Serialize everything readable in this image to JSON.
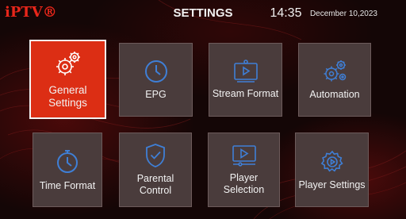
{
  "header": {
    "logo": "iPTV®",
    "title": "SETTINGS",
    "time": "14:35",
    "date": "December 10,2023"
  },
  "tiles": [
    {
      "label": "General Settings",
      "icon": "gears-icon",
      "selected": true
    },
    {
      "label": "EPG",
      "icon": "clock-icon",
      "selected": false
    },
    {
      "label": "Stream Format",
      "icon": "video-player-icon",
      "selected": false
    },
    {
      "label": "Automation",
      "icon": "automation-gears-icon",
      "selected": false
    },
    {
      "label": "Time Format",
      "icon": "stopwatch-icon",
      "selected": false
    },
    {
      "label": "Parental Control",
      "icon": "shield-check-icon",
      "selected": false
    },
    {
      "label": "Player Selection",
      "icon": "player-selection-icon",
      "selected": false
    },
    {
      "label": "Player Settings",
      "icon": "gear-play-icon",
      "selected": false
    }
  ],
  "colors": {
    "accent": "#dc2e14",
    "logo": "#e8261a",
    "tile_bg": "#4a3c3c",
    "icon_blue": "#3f7fd6"
  }
}
